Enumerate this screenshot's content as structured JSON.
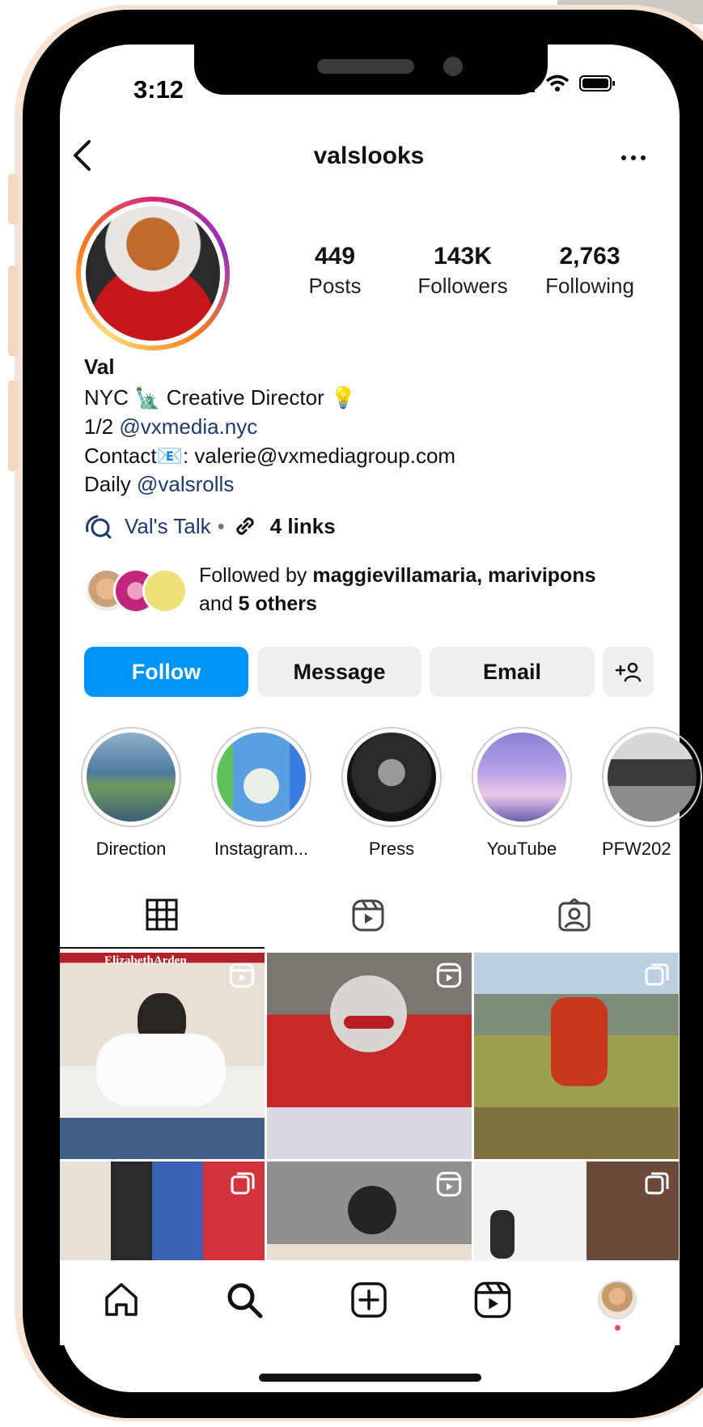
{
  "status_bar": {
    "time": "3:12"
  },
  "header": {
    "username": "valslooks"
  },
  "stats": [
    {
      "value": "449",
      "label": "Posts"
    },
    {
      "value": "143K",
      "label": "Followers"
    },
    {
      "value": "2,763",
      "label": "Following"
    }
  ],
  "bio": {
    "name": "Val",
    "line1_text": "NYC 🗽 Creative Director 💡",
    "line2_prefix": "1/2 ",
    "line2_handle": "@vxmedia.nyc",
    "line3_text": "Contact📧: valerie@vxmediagroup.com",
    "line4_prefix": "Daily ",
    "line4_handle": "@valsrolls"
  },
  "links": {
    "threads_label": "Val's Talk",
    "separator": "•",
    "links_label": "4 links"
  },
  "followed_by": {
    "prefix": "Followed by ",
    "names": "maggievillamaria, marivipons",
    "and_text": "and ",
    "others": "5 others"
  },
  "actions": {
    "follow": "Follow",
    "message": "Message",
    "email": "Email"
  },
  "highlights": [
    {
      "label": "Direction"
    },
    {
      "label": "Instagram..."
    },
    {
      "label": "Press"
    },
    {
      "label": "YouTube"
    },
    {
      "label": "PFW202"
    }
  ],
  "tabs": [
    {
      "icon": "grid-icon"
    },
    {
      "icon": "reels-icon"
    },
    {
      "icon": "tagged-icon"
    }
  ],
  "posts": [
    {
      "type": "reel",
      "overlay_text": "ElizabethArden"
    },
    {
      "type": "reel"
    },
    {
      "type": "carousel"
    },
    {
      "type": "carousel"
    },
    {
      "type": "reel"
    },
    {
      "type": "carousel"
    }
  ],
  "bottom_nav": [
    {
      "icon": "home-icon"
    },
    {
      "icon": "search-icon"
    },
    {
      "icon": "create-icon"
    },
    {
      "icon": "reels-icon"
    },
    {
      "icon": "profile-avatar"
    }
  ],
  "colors": {
    "follow_button": "#0095f6",
    "secondary_button": "#efefef",
    "link_text": "#1c3a6b",
    "notification_dot": "#ed4956",
    "bezel": "#f7e3d3"
  }
}
